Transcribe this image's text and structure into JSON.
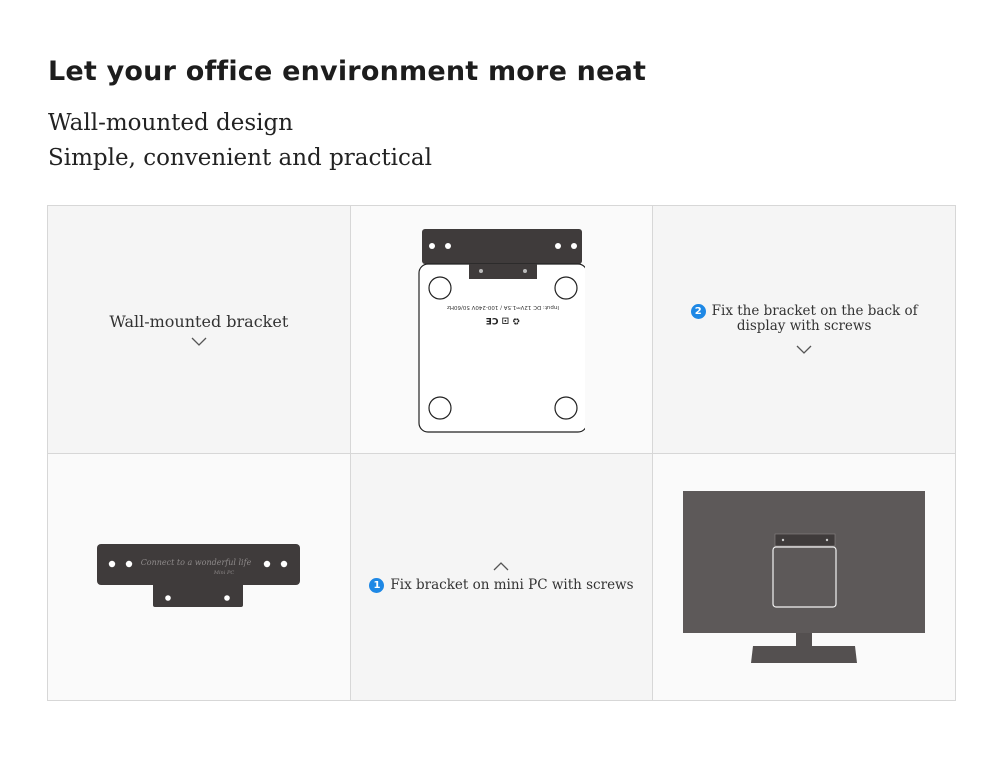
{
  "header": {
    "title": "Let your office environment more neat",
    "subtitle_line1": "Wall-mounted design",
    "subtitle_line2": "Simple, convenient and practical"
  },
  "panels": {
    "bracket_caption": "Wall-mounted bracket",
    "step2": {
      "number": "2",
      "line1": "Fix the bracket on the back of",
      "line2": "display with screws"
    },
    "step1": {
      "number": "1",
      "text": "Fix bracket on mini PC with screws"
    },
    "bracket_engraving": "Connect to a wonderful life",
    "bracket_engraving_small": "Mini PC",
    "pc_rating_label": "Input: DC 12V⎓1.5A / 100-240V 50/60Hz",
    "pc_cert_marks": "♻ ⊡ CE"
  },
  "colors": {
    "accent": "#1e88e5",
    "bracket": "#3f3b3b",
    "monitor": "#5d5959",
    "stand": "#545050"
  }
}
